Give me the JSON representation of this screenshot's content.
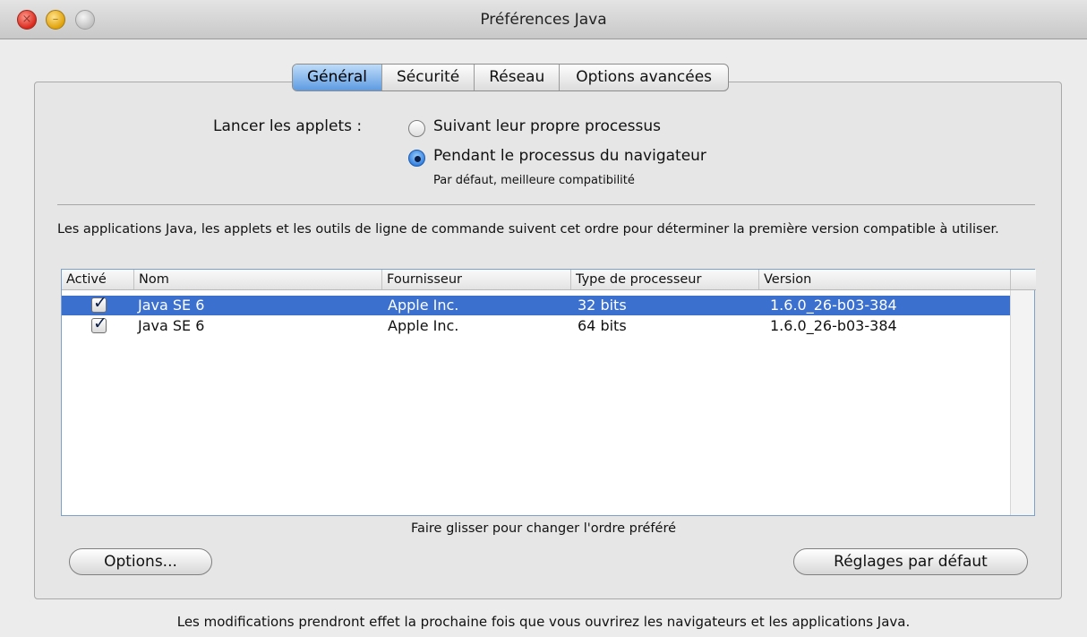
{
  "window": {
    "title": "Préférences Java"
  },
  "tabs": [
    {
      "label": "Général",
      "selected": true
    },
    {
      "label": "Sécurité",
      "selected": false
    },
    {
      "label": "Réseau",
      "selected": false
    },
    {
      "label": "Options avancées",
      "selected": false
    }
  ],
  "launch": {
    "label": "Lancer les applets :",
    "options": [
      {
        "label": "Suivant leur propre processus",
        "checked": false
      },
      {
        "label": "Pendant le processus du navigateur",
        "checked": true
      }
    ],
    "note": "Par défaut, meilleure compatibilité"
  },
  "description": "Les applications Java, les applets et les outils de ligne de commande suivent cet ordre pour déterminer la première version compatible à utiliser.",
  "table": {
    "columns": [
      "Activé",
      "Nom",
      "Fournisseur",
      "Type de processeur",
      "Version"
    ],
    "rows": [
      {
        "enabled": true,
        "name": "Java SE 6",
        "vendor": "Apple Inc.",
        "processor": "32 bits",
        "version": "1.6.0_26-b03-384",
        "selected": true
      },
      {
        "enabled": true,
        "name": "Java SE 6",
        "vendor": "Apple Inc.",
        "processor": "64 bits",
        "version": "1.6.0_26-b03-384",
        "selected": false
      }
    ],
    "drag_hint": "Faire glisser pour changer l'ordre préféré"
  },
  "buttons": {
    "options": "Options...",
    "defaults": "Réglages par défaut"
  },
  "footer": "Les modifications prendront effet la prochaine fois que vous ouvrirez les navigateurs et les applications Java.",
  "colors": {
    "selection": "#3b70cf",
    "tab_selected": "#5d9be2"
  }
}
